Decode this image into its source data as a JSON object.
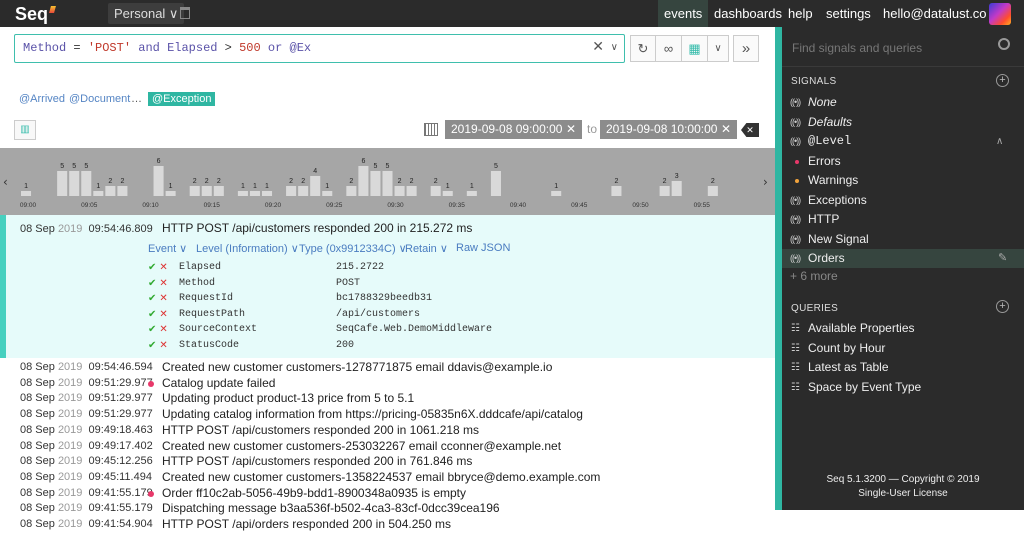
{
  "app": {
    "name": "Seq",
    "workspace": "Personal ∨"
  },
  "nav": {
    "events": "events",
    "dashboards": "dashboards",
    "help": "help",
    "settings": "settings",
    "user": "hello@datalust.co ∨"
  },
  "search": {
    "kw_method": "Method",
    "op_eq": " = ",
    "str_post": "'POST'",
    "kw_and": " and ",
    "kw_elapsed": "Elapsed",
    "op_gt": " > ",
    "num_500": "500",
    "kw_or": " or ",
    "kw_ex": "@Ex",
    "clear": "✕",
    "dropdown": "∨"
  },
  "toolbar": {
    "refresh": "↻",
    "link": "∞",
    "grid": "▦",
    "more": "∨",
    "tail": "»"
  },
  "hints": {
    "arrived": "@Arrived",
    "document": "@Document",
    "ellipsis": "…",
    "exception": "@Exception"
  },
  "range": {
    "from": "2019-09-08 09:00:00",
    "to_label": "to",
    "to": "2019-09-08 10:00:00",
    "clear_x": "✕"
  },
  "histogram": {
    "x_ticks": [
      "09:00",
      "09:05",
      "09:10",
      "09:15",
      "09:20",
      "09:25",
      "09:30",
      "09:35",
      "09:40",
      "09:45",
      "09:50",
      "09:55"
    ],
    "counts": [
      1,
      0,
      0,
      5,
      5,
      5,
      1,
      2,
      2,
      0,
      0,
      6,
      1,
      0,
      2,
      2,
      2,
      0,
      1,
      1,
      1,
      0,
      2,
      2,
      4,
      1,
      0,
      2,
      6,
      5,
      5,
      2,
      2,
      0,
      2,
      1,
      0,
      1,
      0,
      5,
      0,
      0,
      0,
      0,
      1,
      0,
      0,
      0,
      0,
      2,
      0,
      0,
      0,
      2,
      3,
      0,
      0,
      2,
      0,
      0,
      0
    ]
  },
  "open_event": {
    "date": "08 Sep",
    "year": "2019",
    "time": "09:54:46.809",
    "message": "HTTP POST /api/customers responded 200 in 215.272 ms",
    "menu": [
      "Event ∨",
      "Level (Information) ∨",
      "Type (0x9912334C) ∨",
      "Retain ∨",
      "Raw JSON"
    ],
    "properties": [
      {
        "name": "Elapsed",
        "value": "215.2722"
      },
      {
        "name": "Method",
        "value": "POST"
      },
      {
        "name": "RequestId",
        "value": "bc1788329beedb31"
      },
      {
        "name": "RequestPath",
        "value": "/api/customers"
      },
      {
        "name": "SourceContext",
        "value": "SeqCafe.Web.DemoMiddleware"
      },
      {
        "name": "StatusCode",
        "value": "200"
      }
    ]
  },
  "events": [
    {
      "date": "08 Sep",
      "year": "2019",
      "time": "09:54:46.594",
      "message": "Created new customer customers-1278771875 email ddavis@example.io",
      "error": false
    },
    {
      "date": "08 Sep",
      "year": "2019",
      "time": "09:51:29.977",
      "message": "Catalog update failed",
      "error": true
    },
    {
      "date": "08 Sep",
      "year": "2019",
      "time": "09:51:29.977",
      "message": "Updating product product-13 price from 5 to 5.1",
      "error": false
    },
    {
      "date": "08 Sep",
      "year": "2019",
      "time": "09:51:29.977",
      "message": "Updating catalog information from https://pricing-05835n6X.dddcafe/api/catalog",
      "error": false
    },
    {
      "date": "08 Sep",
      "year": "2019",
      "time": "09:49:18.463",
      "message": "HTTP POST /api/customers responded 200 in 1061.218 ms",
      "error": false
    },
    {
      "date": "08 Sep",
      "year": "2019",
      "time": "09:49:17.402",
      "message": "Created new customer customers-253032267 email cconner@example.net",
      "error": false
    },
    {
      "date": "08 Sep",
      "year": "2019",
      "time": "09:45:12.256",
      "message": "HTTP POST /api/customers responded 200 in 761.846 ms",
      "error": false
    },
    {
      "date": "08 Sep",
      "year": "2019",
      "time": "09:45:11.494",
      "message": "Created new customer customers-1358224537 email bbryce@demo.example.com",
      "error": false
    },
    {
      "date": "08 Sep",
      "year": "2019",
      "time": "09:41:55.179",
      "message": "Order ff10c2ab-5056-49b9-bdd1-8900348a0935 is empty",
      "error": true
    },
    {
      "date": "08 Sep",
      "year": "2019",
      "time": "09:41:55.179",
      "message": "Dispatching message b3aa536f-b502-4ca3-83cf-0dcc39cea196",
      "error": false
    },
    {
      "date": "08 Sep",
      "year": "2019",
      "time": "09:41:54.904",
      "message": "HTTP POST /api/orders responded 200 in 504.250 ms",
      "error": false
    }
  ],
  "sidebar": {
    "search_placeholder": "Find signals and queries",
    "signals_head": "SIGNALS",
    "signals": [
      {
        "label": "None",
        "italic": true,
        "kind": "radio"
      },
      {
        "label": "Defaults",
        "italic": true,
        "kind": "radio"
      },
      {
        "label": "@Level",
        "italic": false,
        "kind": "radio",
        "mono": true,
        "chevron": "∧"
      },
      {
        "label": "Errors",
        "italic": false,
        "kind": "bullet",
        "color": "#e8386a"
      },
      {
        "label": "Warnings",
        "italic": false,
        "kind": "bullet",
        "color": "#f0a23b"
      },
      {
        "label": "Exceptions",
        "italic": false,
        "kind": "radio"
      },
      {
        "label": "HTTP",
        "italic": false,
        "kind": "radio"
      },
      {
        "label": "New Signal",
        "italic": false,
        "kind": "radio"
      },
      {
        "label": "Orders",
        "italic": false,
        "kind": "radio",
        "selected": true,
        "edit": "✎"
      }
    ],
    "more": "+ 6 more",
    "queries_head": "QUERIES",
    "queries": [
      "Available Properties",
      "Count by Hour",
      "Latest as Table",
      "Space by Event Type"
    ],
    "footer_line1": "Seq 5.1.3200 — Copyright © 2019",
    "footer_line2": "Single-User License"
  },
  "colors": {
    "accent": "#2fb6a2",
    "error": "#e8386a",
    "warning": "#f0a23b",
    "topbar": "#2b2b2b"
  }
}
